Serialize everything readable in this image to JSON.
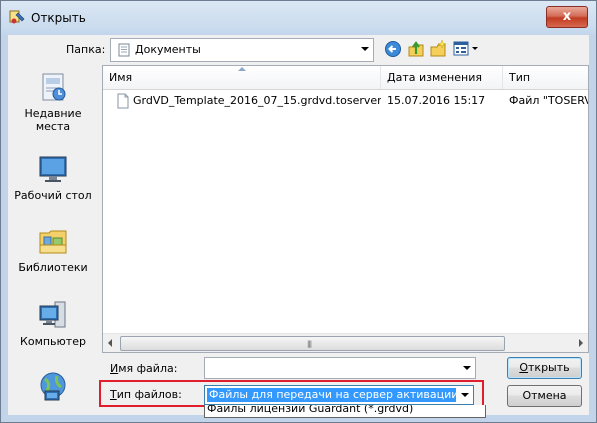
{
  "window": {
    "title": "Открыть",
    "close_label": "x"
  },
  "lookin": {
    "label": "Папка:",
    "value": "Документы"
  },
  "toolbar": {
    "back_icon": "back-arrow-icon",
    "up_icon": "up-folder-icon",
    "newfolder_icon": "new-folder-icon",
    "views_icon": "views-menu-icon"
  },
  "places": [
    {
      "label_line1": "Недавние",
      "label_line2": "места",
      "icon": "recent-places-icon"
    },
    {
      "label_line1": "Рабочий стол",
      "label_line2": "",
      "icon": "desktop-icon"
    },
    {
      "label_line1": "Библиотеки",
      "label_line2": "",
      "icon": "libraries-icon"
    },
    {
      "label_line1": "Компьютер",
      "label_line2": "",
      "icon": "computer-icon"
    },
    {
      "label_line1": "",
      "label_line2": "",
      "icon": "network-icon"
    }
  ],
  "columns": {
    "name": "Имя",
    "date": "Дата изменения",
    "type": "Тип"
  },
  "files": [
    {
      "name": "GrdVD_Template_2016_07_15.grdvd.toserver",
      "date": "15.07.2016 15:17",
      "type": "Файл \"TOSERVER\""
    }
  ],
  "filename": {
    "label_pre": "",
    "label_acc": "И",
    "label_post": "мя файла:",
    "value": ""
  },
  "filetype": {
    "label_pre": "",
    "label_acc": "Т",
    "label_post": "ип файлов:",
    "selected": "Файлы для передачи на сервер активации (*.toserver)",
    "next_option": "Файлы лицензий Guardant (*.grdvd)"
  },
  "buttons": {
    "open_acc": "О",
    "open_rest": "ткрыть",
    "cancel": "Отмена"
  },
  "colors": {
    "highlight": "#3399ff",
    "outline": "#e01e2d"
  }
}
